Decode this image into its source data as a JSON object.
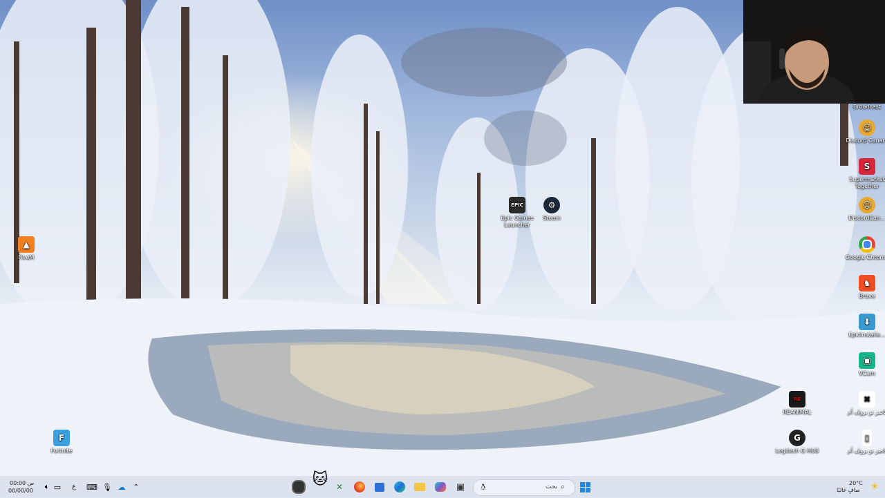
{
  "desktop": {
    "icons_left": [
      {
        "id": "fivem",
        "label": "FiveM",
        "icon": "fivem-icon",
        "color": "#f08020"
      },
      {
        "id": "fortnite",
        "label": "Fortnite",
        "icon": "fortnite-icon",
        "color": "#3aa0e0"
      }
    ],
    "icons_middle": [
      {
        "id": "epic",
        "label": "Epic Games Launcher",
        "icon": "epic-games-icon",
        "color": "#2a2a2a"
      },
      {
        "id": "steam",
        "label": "Steam",
        "icon": "steam-icon",
        "color": "#1b2838"
      }
    ],
    "icons_right": [
      {
        "id": "broadcast",
        "label": "Broadcast"
      },
      {
        "id": "discord-canary",
        "label": "Discord Canary",
        "icon": "discord-canary-icon",
        "color": "#e8a930"
      },
      {
        "id": "supermarket",
        "label": "Supermarket Together",
        "icon": "supermarket-together-icon",
        "color": "#d9263a"
      },
      {
        "id": "discordcan",
        "label": "DiscordCan...",
        "icon": "discord-canary-icon",
        "color": "#e8a930"
      },
      {
        "id": "chrome",
        "label": "Google Chrome",
        "icon": "chrome-icon",
        "color": "#4285f4"
      },
      {
        "id": "brave",
        "label": "Brave",
        "icon": "brave-icon",
        "color": "#f04e23"
      },
      {
        "id": "epicinstaller",
        "label": "EpicInstalle...",
        "icon": "installer-icon",
        "color": "#3a9ad0"
      },
      {
        "id": "vcam",
        "label": "VCam",
        "icon": "vcam-icon",
        "color": "#19b58a"
      },
      {
        "id": "reanimal",
        "label": "REANIMAL",
        "icon": "reanimal-icon",
        "color": "#1a1a1a"
      },
      {
        "id": "nasser1",
        "label": "ناصر نو بروڤ أم",
        "icon": "shortcut-icon",
        "color": "#ffffff"
      },
      {
        "id": "logitech",
        "label": "Logitech G HUB",
        "icon": "logitech-g-icon",
        "color": "#222222"
      },
      {
        "id": "nasser2",
        "label": "ناصر نو بروڤ أم",
        "icon": "file-icon",
        "color": "#ffffff"
      }
    ]
  },
  "taskbar": {
    "clock_time": "00:00 ص",
    "clock_date": "00/00/00",
    "lang": "ع",
    "search_placeholder": "بحث",
    "weather_temp": "20°C",
    "weather_desc": "صافٍ غالبًا",
    "tray_icons": [
      "volume-icon",
      "network-icon",
      "keyboard-icon",
      "microphone-icon",
      "onedrive-icon",
      "chevron-up-icon"
    ],
    "apps": [
      {
        "id": "obs",
        "icon": "obs-icon"
      },
      {
        "id": "mascot",
        "icon": "mascot-icon"
      },
      {
        "id": "xbox",
        "icon": "xbox-icon"
      },
      {
        "id": "firefox",
        "icon": "firefox-icon"
      },
      {
        "id": "store",
        "icon": "microsoft-store-icon"
      },
      {
        "id": "edge",
        "icon": "edge-icon"
      },
      {
        "id": "explorer",
        "icon": "file-explorer-icon"
      },
      {
        "id": "copilot",
        "icon": "copilot-icon"
      },
      {
        "id": "taskview",
        "icon": "task-view-icon"
      },
      {
        "id": "start",
        "icon": "windows-start-icon"
      }
    ]
  },
  "colors": {
    "taskbar_bg": "#dae2ee",
    "accent": "#0078d4"
  }
}
